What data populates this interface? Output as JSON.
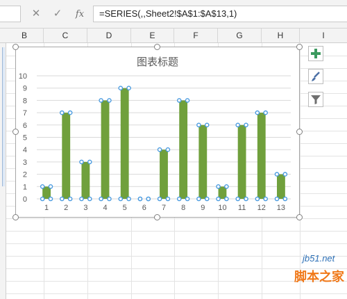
{
  "formula_bar": {
    "cancel_icon": "cancel-x-icon",
    "confirm_icon": "check-icon",
    "fx_label": "fx",
    "formula": "=SERIES(,,Sheet2!$A$1:$A$13,1)"
  },
  "columns": [
    "B",
    "C",
    "D",
    "E",
    "F",
    "G",
    "H",
    "I"
  ],
  "chart": {
    "title": "图表标题",
    "side_buttons": [
      "chart-elements-plus-icon",
      "chart-styles-brush-icon",
      "chart-filters-funnel-icon"
    ]
  },
  "chart_data": {
    "type": "bar",
    "title": "图表标题",
    "categories": [
      "1",
      "2",
      "3",
      "4",
      "5",
      "6",
      "7",
      "8",
      "9",
      "10",
      "11",
      "12",
      "13"
    ],
    "values": [
      1,
      7,
      3,
      8,
      9,
      0,
      4,
      8,
      6,
      1,
      6,
      7,
      2
    ],
    "ylim": [
      0,
      10
    ],
    "yticks": [
      "0",
      "1",
      "2",
      "3",
      "4",
      "5",
      "6",
      "7",
      "8",
      "9",
      "10"
    ],
    "grid": true,
    "legend": "none",
    "bar_color": "#70a03c",
    "selection_handle_color": "#4a9be0"
  },
  "watermark": {
    "url": "jb51.net",
    "text": "脚本之家"
  }
}
